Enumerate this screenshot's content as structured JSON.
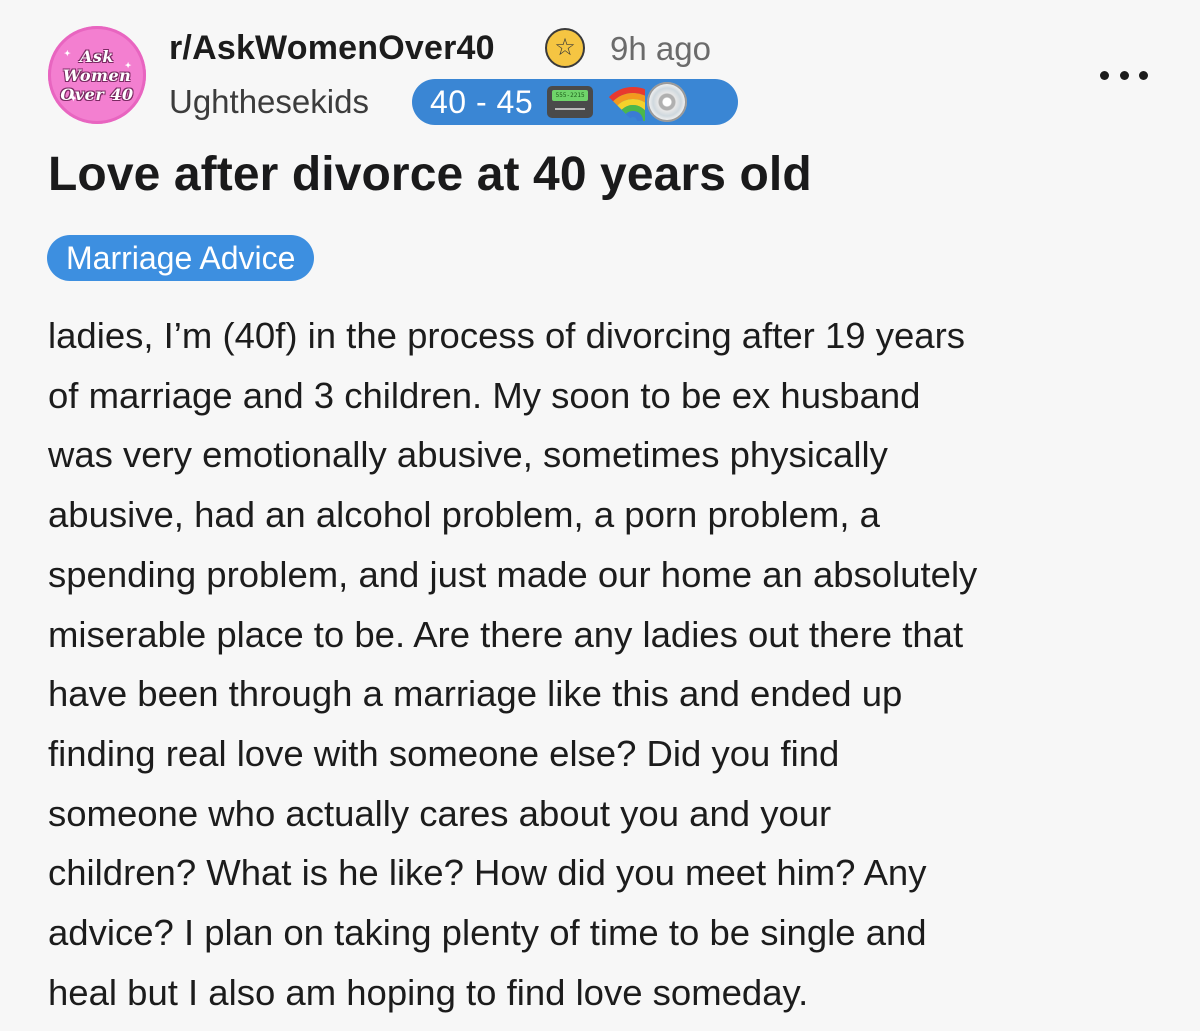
{
  "post": {
    "subreddit": "r/AskWomenOver40",
    "time_ago": "9h ago",
    "username": "Ughthesekids",
    "user_flair": "40 - 45",
    "user_flair_icons": [
      "pager-icon",
      "rainbow-icon",
      "cd-icon"
    ],
    "subreddit_avatar_text": [
      "Ask",
      "Women",
      "Over 40"
    ],
    "title": "Love after divorce at 40 years old",
    "post_flair": "Marriage Advice",
    "body_lines": [
      "ladies, I’m (40f) in the process of divorcing after 19 years",
      "of marriage and 3 children. My soon to be ex husband",
      "was very emotionally abusive, sometimes physically",
      "abusive, had an alcohol problem, a porn problem, a",
      "spending problem, and just made our home an absolutely",
      "miserable place to be. Are there any ladies out there that",
      "have been through a marriage like this and ended up",
      "finding real love with someone else? Did you find",
      "someone who actually cares about you and your",
      "children? What is he like? How did you meet him? Any",
      "advice? I plan on taking plenty of time to be single and",
      "heal but I also am hoping to find love someday."
    ]
  },
  "colors": {
    "background": "#f7f7f7",
    "avatar_pink": "#f37fd0",
    "flair_blue": "#3a86d4",
    "post_flair_blue": "#3d8fe0",
    "star_gold": "#f5c542"
  }
}
